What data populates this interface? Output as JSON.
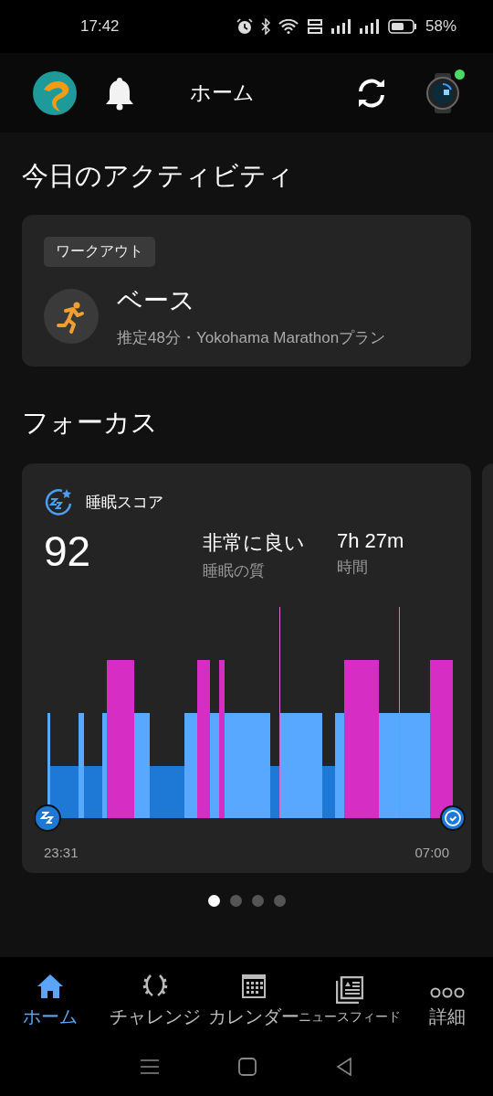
{
  "status_bar": {
    "time": "17:42",
    "battery": "58%"
  },
  "header": {
    "title": "ホーム",
    "device_connected": true
  },
  "today": {
    "heading": "今日のアクティビティ",
    "tag": "ワークアウト",
    "title": "ベース",
    "subtitle": "推定48分・Yokohama Marathonプラン"
  },
  "focus": {
    "heading": "フォーカス",
    "card": {
      "title": "睡眠スコア",
      "score": "92",
      "quality": "非常に良い",
      "quality_label": "睡眠の質",
      "duration": "7h 27m",
      "duration_label": "時間",
      "start": "23:31",
      "end": "07:00"
    }
  },
  "pager": [
    {
      "selected": true
    },
    {
      "selected": false
    },
    {
      "selected": false
    },
    {
      "selected": false
    }
  ],
  "nav": [
    {
      "kind": "home",
      "label": "ホーム",
      "selected": true
    },
    {
      "kind": "challenge",
      "label": "チャレンジ",
      "selected": false
    },
    {
      "kind": "calendar",
      "label": "カレンダー",
      "selected": false
    },
    {
      "kind": "news",
      "label": "ニュースフィード",
      "selected": false
    },
    {
      "kind": "more",
      "label": "詳細",
      "selected": false
    }
  ]
}
